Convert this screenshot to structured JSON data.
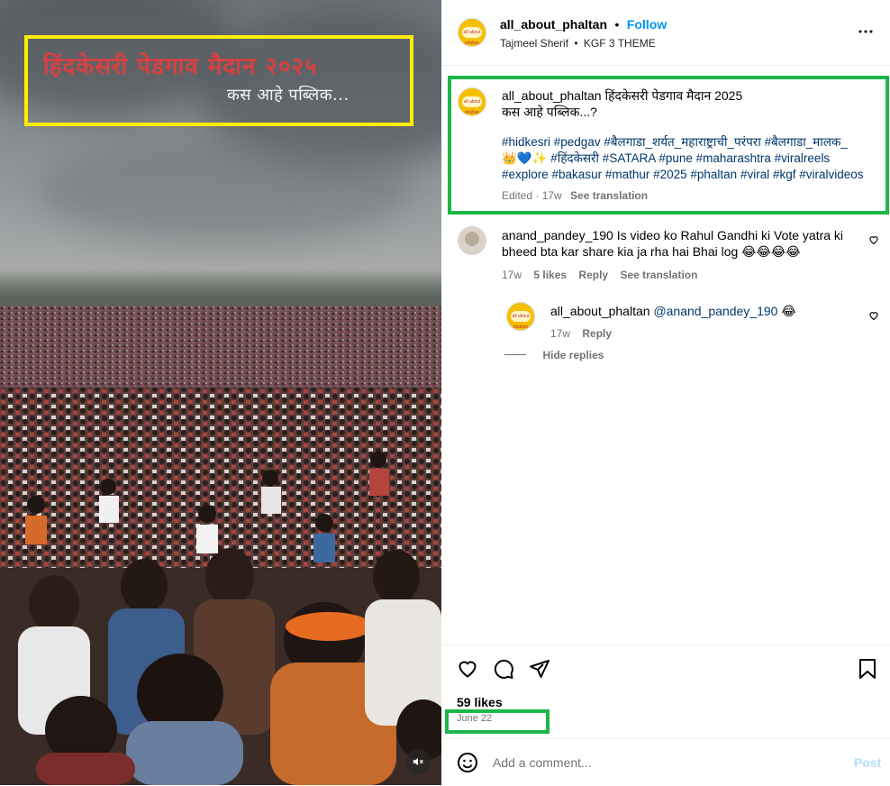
{
  "video": {
    "overlay_title": "हिंदकेसरी पेडगाव मैदान २०२५",
    "overlay_subtitle": "कस आहे पब्लिक..."
  },
  "header": {
    "username": "all_about_phaltan",
    "separator": "•",
    "follow_label": "Follow",
    "audio": "Tajmeel Sherif",
    "audio_sep": "•",
    "audio_track": "KGF 3 THEME",
    "avatar_text": "all about phaltan"
  },
  "caption": {
    "username": "all_about_phaltan",
    "text_line1": "हिंदकेसरी पेडगाव मैदान 2025",
    "text_line2": "कस आहे पब्लिक...?",
    "hashtags_line1": "#hidkesri #pedgav #बैलगाडा_शर्यत_महाराष्ट्राची_परंपरा #बैलगाडा_मालक_",
    "hashtags_line2_emoji": "👑💙✨",
    "hashtags_line2": "#हिंदकेसरी #SATARA #pune #maharashtra #viralreels",
    "hashtags_line3": "#explore #bakasur #mathur #2025 #phaltan #viral #kgf #viralvideos",
    "meta": "Edited · 17w",
    "see_translation": "See translation"
  },
  "comments": [
    {
      "username": "anand_pandey_190",
      "text_line1": "Is video ko Rahul Gandhi ki Vote yatra ki",
      "text_line2": "bheed bta kar share kia ja rha hai Bhai log",
      "emoji": "😂😂😂😂",
      "time": "17w",
      "likes": "5 likes",
      "reply": "Reply",
      "see_translation": "See translation"
    },
    {
      "username": "all_about_phaltan",
      "mention": "@anand_pandey_190",
      "emoji": "😂",
      "time": "17w",
      "reply": "Reply"
    }
  ],
  "hide_replies": "Hide replies",
  "likes": "59 likes",
  "date": "June 22",
  "comment_input": {
    "placeholder": "Add a comment...",
    "post_label": "Post"
  },
  "colors": {
    "follow": "#0095f6",
    "hashtag": "#00376b",
    "highlight_green": "#1db64a",
    "highlight_yellow": "#ffee00"
  }
}
